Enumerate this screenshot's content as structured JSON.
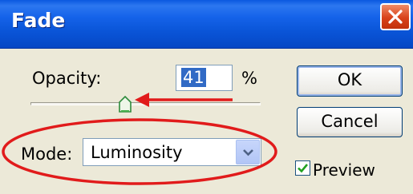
{
  "window": {
    "title": "Fade"
  },
  "opacity": {
    "label": "Opacity:",
    "value": "41",
    "unit": "%",
    "slider_level_percent": 41
  },
  "mode": {
    "label": "Mode:",
    "selected": "Luminosity"
  },
  "buttons": {
    "ok": "OK",
    "cancel": "Cancel"
  },
  "preview": {
    "label": "Preview",
    "checked": true
  },
  "colors": {
    "title_bar": "#0a55d8",
    "dialog_background": "#ece9d8",
    "annotation_red": "#e11b1b",
    "close_button": "#d8421a",
    "selection_highlight": "#316ac5"
  },
  "icons": {
    "close": "close-x-icon",
    "dropdown": "chevron-down-icon",
    "checkbox": "checkmark-icon",
    "slider": "slider-thumb-icon"
  }
}
